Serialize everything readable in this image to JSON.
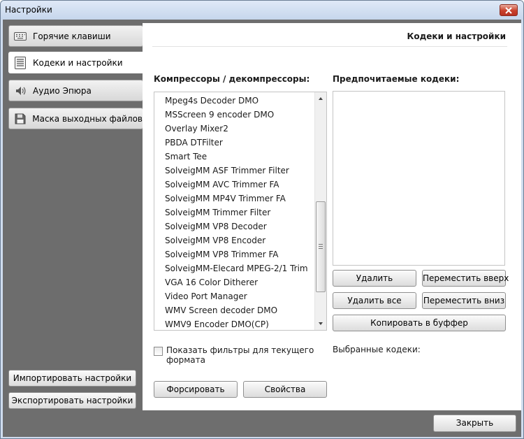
{
  "window": {
    "title": "Настройки"
  },
  "sidebar": {
    "items": [
      {
        "label": "Горячие клавиши",
        "icon": "keyboard-icon"
      },
      {
        "label": "Кодеки и настройки",
        "icon": "list-icon"
      },
      {
        "label": "Аудио Эпюра",
        "icon": "speaker-icon"
      },
      {
        "label": "Маска выходных файлов",
        "icon": "floppy-disk-icon"
      }
    ],
    "import_label": "Импортировать настройки",
    "export_label": "Экспортировать настройки"
  },
  "content": {
    "title": "Кодеки и настройки",
    "compressors_label": "Компрессоры / декомпрессоры:",
    "preferred_label": "Предпочитаемые кодеки:",
    "codecs": [
      "Mpeg4s Decoder DMO",
      "MSScreen 9 encoder DMO",
      "Overlay Mixer2",
      "PBDA DTFilter",
      "Smart Tee",
      "SolveigMM ASF Trimmer Filter",
      "SolveigMM AVC Trimmer FA",
      "SolveigMM MP4V Trimmer FA",
      "SolveigMM Trimmer Filter",
      "SolveigMM VP8 Decoder",
      "SolveigMM VP8 Encoder",
      "SolveigMM VP8 Trimmer FA",
      "SolveigMM-Elecard MPEG-2/1 Trim",
      "VGA 16 Color Ditherer",
      "Video Port Manager",
      "WMV Screen decoder DMO",
      "WMV9 Encoder DMO(CP)"
    ],
    "preferred_codecs": [],
    "buttons": {
      "delete": "Удалить",
      "move_up": "Переместить вверх",
      "delete_all": "Удалить все",
      "move_down": "Переместить вниз",
      "copy": "Копировать в буффер",
      "force": "Форсировать",
      "properties": "Свойства"
    },
    "show_filters": {
      "line1": "Показать фильтры для текущего",
      "line2": "формата",
      "checked": false
    },
    "selected_codecs_label": "Выбранные кодеки:"
  },
  "footer": {
    "close_label": "Закрыть"
  },
  "colors": {
    "sidebar_bg": "#6d6d6d",
    "content_bg": "#ffffff",
    "titlebar": "#c6d6ec",
    "close_button": "#c9402b"
  }
}
